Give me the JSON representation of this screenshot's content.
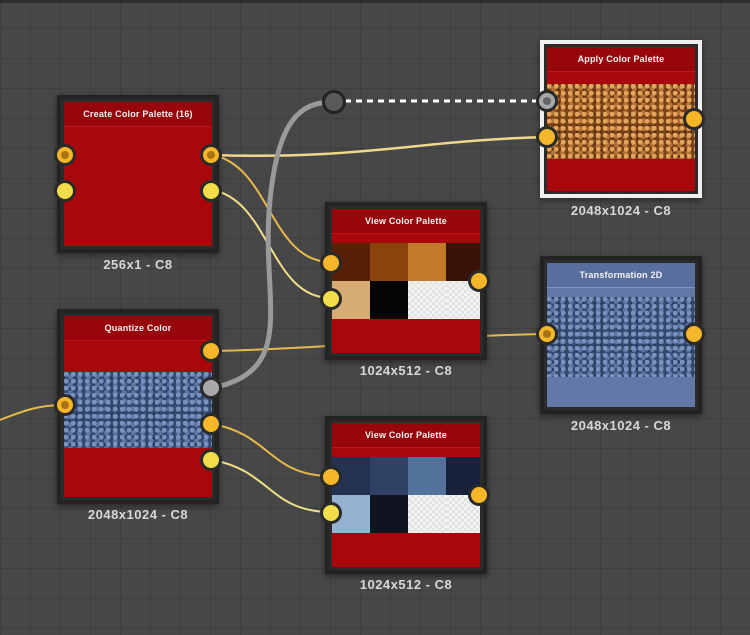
{
  "nodes": {
    "create_palette": {
      "title": "Create Color Palette (16)",
      "label": "256x1 - C8"
    },
    "quantize": {
      "title": "Quantize Color",
      "label": "2048x1024 - C8"
    },
    "view_palette_1": {
      "title": "View Color Palette",
      "label": "1024x512 - C8",
      "swatches": [
        "#5a2006",
        "#8a430c",
        "#c07a2a",
        "#3a1206",
        "#d6ac74",
        "#050505",
        "#f3f3f3",
        "#f3f3f3"
      ]
    },
    "view_palette_2": {
      "title": "View Color Palette",
      "label": "1024x512 - C8",
      "swatches": [
        "#233250",
        "#2f4266",
        "#52729a",
        "#18223a",
        "#96b2d2",
        "#101420",
        "#f3f3f3",
        "#f3f3f3"
      ]
    },
    "apply_palette": {
      "title": "Apply Color Palette",
      "label": "2048x1024 - C8"
    },
    "transform_2d": {
      "title": "Transformation 2D",
      "label": "2048x1024 - C8"
    }
  },
  "colors": {
    "node_body": "#a8070b",
    "wire": "#e7b94d",
    "wire_grey": "#9a9a9a",
    "port_orange": "#f5b62a",
    "port_yellow": "#f2dd4a",
    "transform_body": "#6478a8"
  }
}
